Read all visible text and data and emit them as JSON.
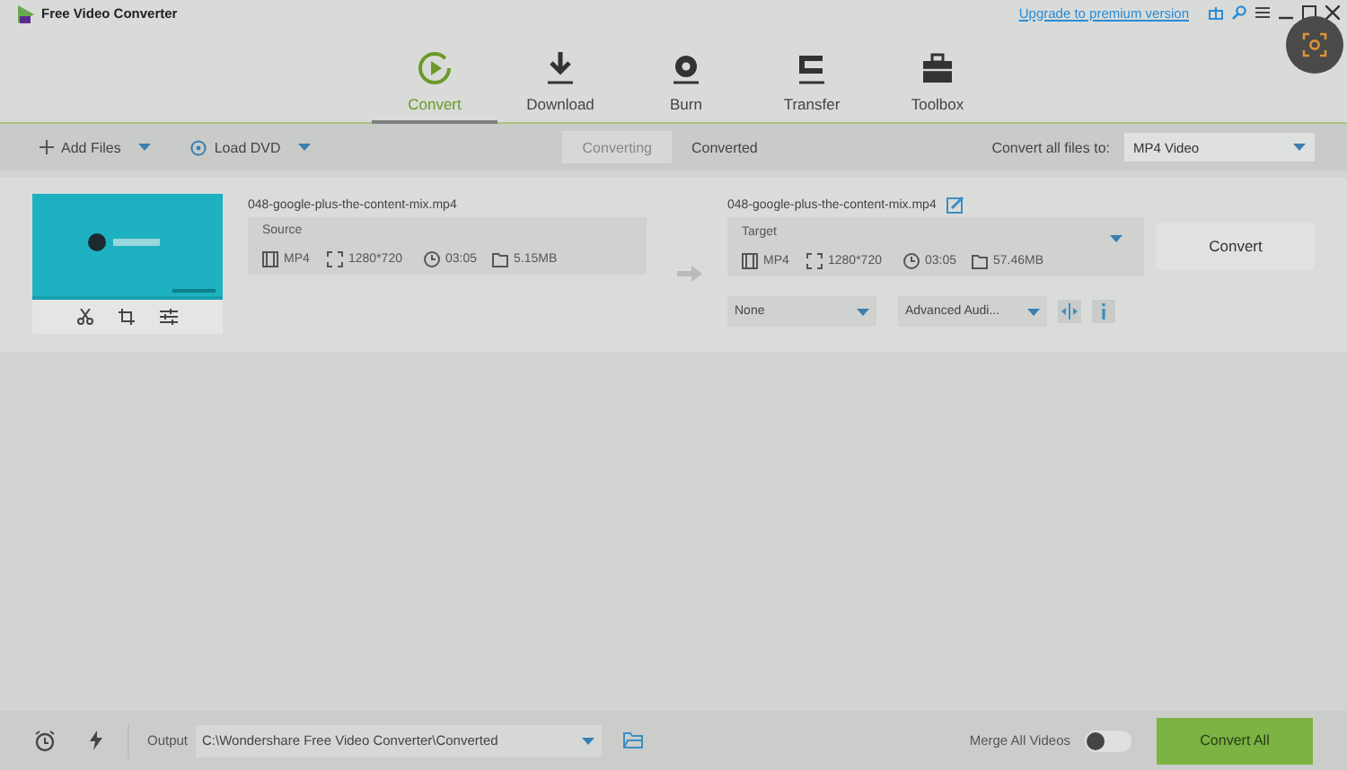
{
  "window": {
    "title": "Free Video Converter",
    "upgrade_link": "Upgrade to premium version"
  },
  "nav_tabs": [
    {
      "label": "Convert",
      "kind": "convert",
      "selected": true
    },
    {
      "label": "Download",
      "kind": "download",
      "selected": false
    },
    {
      "label": "Burn",
      "kind": "burn",
      "selected": false
    },
    {
      "label": "Transfer",
      "kind": "transfer",
      "selected": false
    },
    {
      "label": "Toolbox",
      "kind": "toolbox",
      "selected": false
    }
  ],
  "toolbar": {
    "add_files": "Add Files",
    "load_dvd": "Load DVD",
    "view_tabs": [
      {
        "label": "Converting",
        "selected": true
      },
      {
        "label": "Converted",
        "selected": false
      }
    ],
    "convert_all_label": "Convert all files to:",
    "format": "MP4 Video"
  },
  "files": [
    {
      "name": "048-google-plus-the-content-mix.mp4",
      "source": {
        "label": "Source",
        "format": "MP4",
        "resolution": "1280*720",
        "duration": "03:05",
        "size": "5.15MB"
      },
      "target_name": "048-google-plus-the-content-mix.mp4",
      "target": {
        "label": "Target",
        "format": "MP4",
        "resolution": "1280*720",
        "duration": "03:05",
        "size": "57.46MB"
      },
      "subtitle": "None",
      "audio": "Advanced Audi...",
      "convert_button": "Convert"
    }
  ],
  "footer": {
    "output_label": "Output",
    "output_path": "C:\\Wondershare Free Video Converter\\Converted",
    "merge_label": "Merge All Videos",
    "merge_on": false,
    "convert_all": "Convert All"
  }
}
